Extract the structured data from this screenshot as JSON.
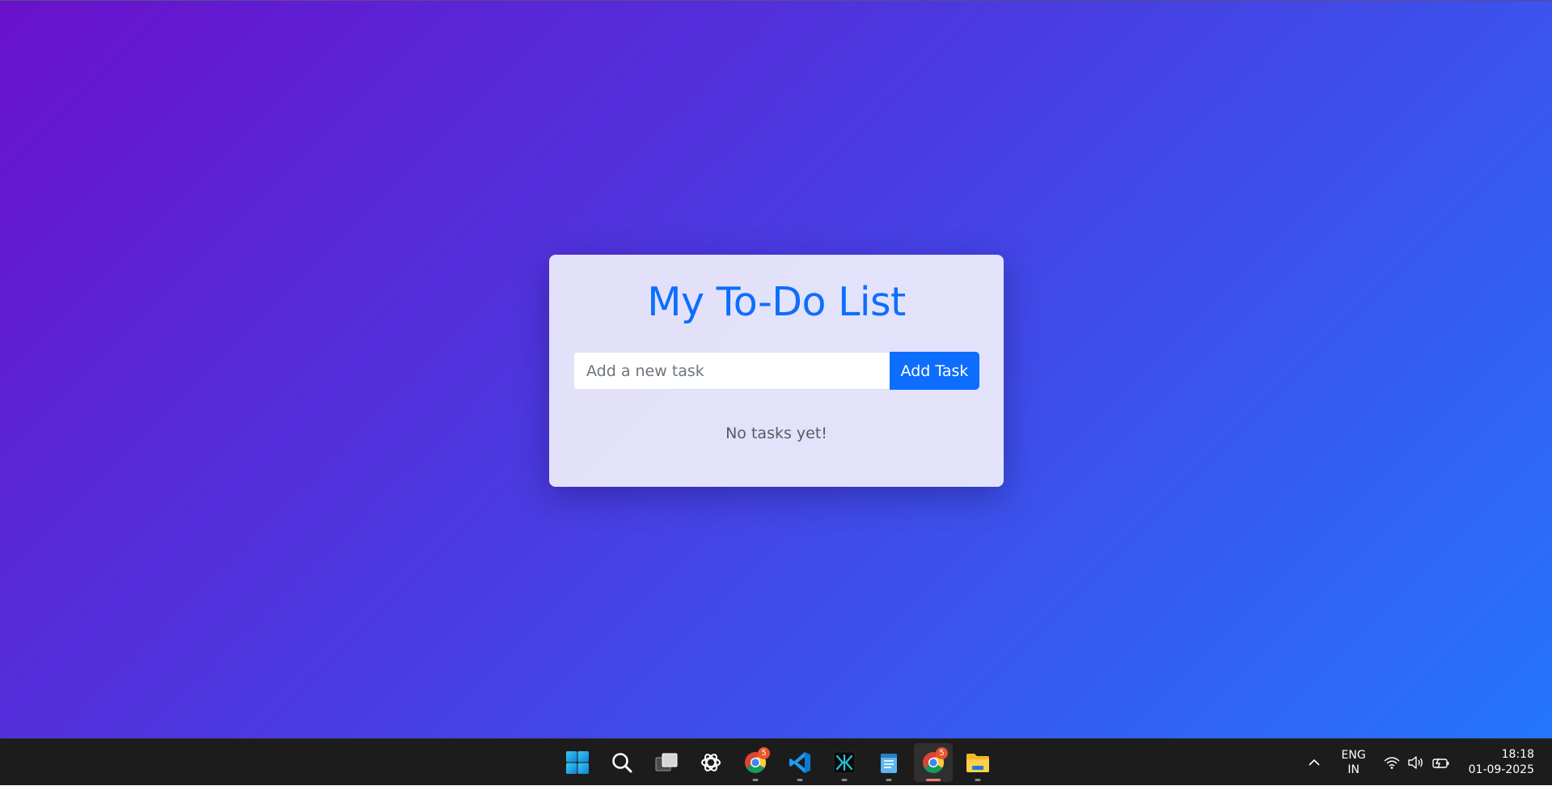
{
  "app": {
    "title": "My To-Do List",
    "input_placeholder": "Add a new task",
    "input_value": "",
    "add_button_label": "Add Task",
    "empty_message": "No tasks yet!"
  },
  "colors": {
    "background_gradient_start": "#6a11cb",
    "background_gradient_end": "#2575fc",
    "accent": "#0d6efd",
    "card_background": "#f0f0fc",
    "taskbar": "#1c1c1c",
    "badge": "#e8542a"
  },
  "taskbar": {
    "apps": [
      {
        "name": "start-icon"
      },
      {
        "name": "search-icon"
      },
      {
        "name": "task-view-icon"
      },
      {
        "name": "chatgpt-icon"
      },
      {
        "name": "chrome-icon",
        "badge": "5",
        "running": true
      },
      {
        "name": "vscode-icon",
        "running": true
      },
      {
        "name": "terminal-app-icon",
        "running": true
      },
      {
        "name": "notepad-icon",
        "running": true
      },
      {
        "name": "chrome-icon",
        "badge": "5",
        "running": true,
        "active": true
      },
      {
        "name": "file-explorer-icon",
        "running": true
      }
    ],
    "tray": {
      "lang_line1": "ENG",
      "lang_line2": "IN",
      "time": "18:18",
      "date": "01-09-2025",
      "icons": [
        "chevron-up-icon",
        "wifi-icon",
        "volume-icon",
        "battery-icon"
      ]
    }
  }
}
